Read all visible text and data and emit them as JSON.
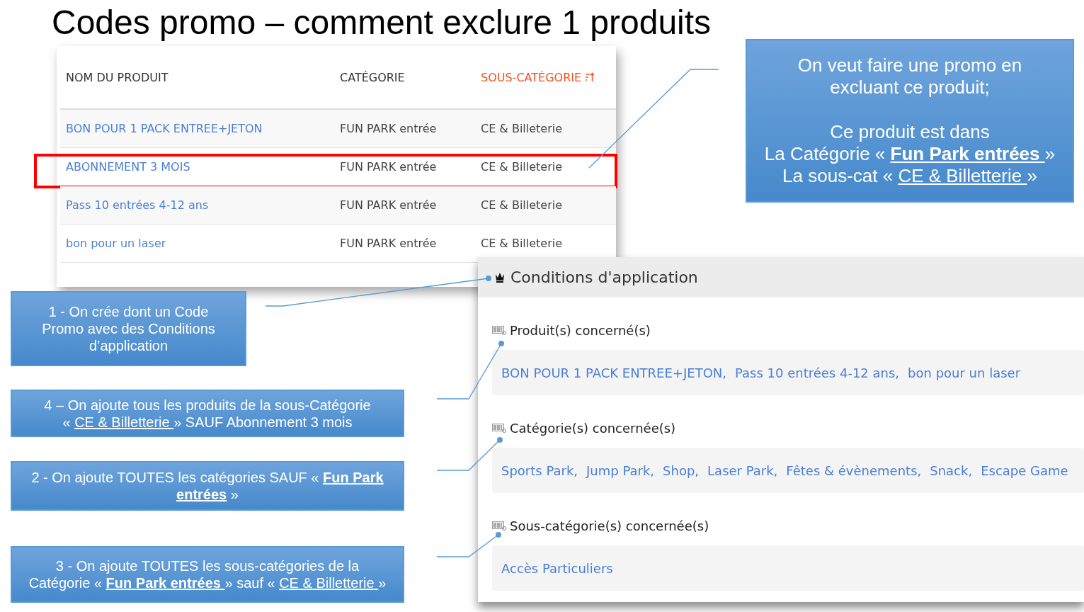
{
  "title": "Codes promo – comment exclure 1 produits",
  "product_table": {
    "columns": [
      {
        "label": "NOM DU PRODUIT",
        "sorted": false
      },
      {
        "label": "CATÉGORIE",
        "sorted": false
      },
      {
        "label": "SOUS-CATÉGORIE",
        "sorted": true
      }
    ],
    "rows": [
      {
        "cells": [
          "BON POUR 1 PACK ENTREE+JETON",
          "FUN PARK entrée",
          "CE & Billeterie"
        ],
        "highlighted": false
      },
      {
        "cells": [
          "ABONNEMENT 3 MOIS",
          "FUN PARK entrée",
          "CE & Billeterie"
        ],
        "highlighted": true
      },
      {
        "cells": [
          "Pass 10 entrées 4-12 ans",
          "FUN PARK entrée",
          "CE & Billeterie"
        ],
        "highlighted": false
      },
      {
        "cells": [
          "bon pour un laser",
          "FUN PARK entrée",
          "CE & Billeterie"
        ],
        "highlighted": false
      }
    ]
  },
  "conditions": {
    "title": "Conditions d'application",
    "sections": [
      {
        "label": "Produit(s) concerné(s)",
        "items": [
          "BON POUR 1 PACK ENTREE+JETON,",
          "Pass 10 entrées 4-12 ans,",
          "bon pour un laser"
        ]
      },
      {
        "label": "Catégorie(s) concernée(s)",
        "items": [
          "Sports Park,",
          "Jump Park,",
          "Shop,",
          "Laser Park,",
          "Fêtes & évènements,",
          "Snack,",
          "Escape Game"
        ]
      },
      {
        "label": "Sous-catégorie(s) concernée(s)",
        "items": [
          "Accès Particuliers"
        ]
      }
    ]
  },
  "callouts": [
    {
      "kind": "intro",
      "segments": [
        {
          "text": "On veut faire une promo en\nexcluant ce produit;\n\nCe produit est dans\nLa Catégorie « ",
          "kind": "plain"
        },
        {
          "text": "Fun Park entrées ",
          "kind": "strong"
        },
        {
          "text": "»\nLa sous-cat « ",
          "kind": "plain"
        },
        {
          "text": "CE & Billetterie ",
          "kind": "underlined"
        },
        {
          "text": "»",
          "kind": "plain"
        }
      ]
    },
    {
      "kind": "step1",
      "segments": [
        {
          "text": "1 - On crée dont un Code Promo avec des Conditions d’application",
          "kind": "plain"
        }
      ]
    },
    {
      "kind": "step4",
      "segments": [
        {
          "text": "4 – On ajoute tous les produits de la sous-Catégorie\n« ",
          "kind": "plain"
        },
        {
          "text": "CE & Billetterie ",
          "kind": "underlined"
        },
        {
          "text": "» SAUF Abonnement 3 mois",
          "kind": "plain"
        }
      ]
    },
    {
      "kind": "step2",
      "segments": [
        {
          "text": "2 - On ajoute TOUTES les catégories SAUF « ",
          "kind": "plain"
        },
        {
          "text": "Fun Park entrées",
          "kind": "strong"
        },
        {
          "text": " »",
          "kind": "plain"
        }
      ]
    },
    {
      "kind": "step3",
      "segments": [
        {
          "text": "3 - On ajoute TOUTES les sous-catégories de la Catégorie « ",
          "kind": "plain"
        },
        {
          "text": "Fun Park entrées ",
          "kind": "strong"
        },
        {
          "text": "» sauf « ",
          "kind": "plain"
        },
        {
          "text": "CE & Billetterie ",
          "kind": "underlined"
        },
        {
          "text": "»",
          "kind": "plain"
        }
      ]
    }
  ]
}
